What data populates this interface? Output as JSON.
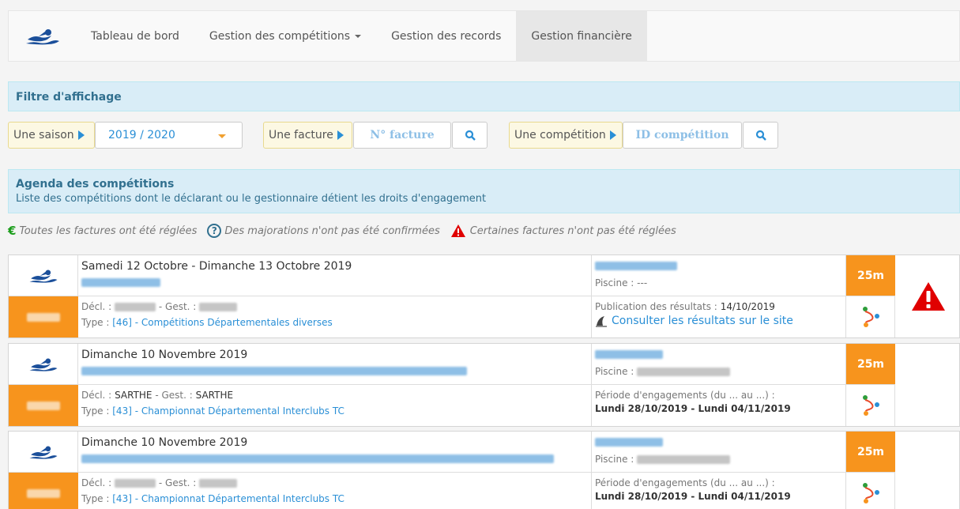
{
  "nav": {
    "items": [
      {
        "label": "Tableau de bord"
      },
      {
        "label": "Gestion des compétitions"
      },
      {
        "label": "Gestion des records"
      },
      {
        "label": "Gestion financière"
      }
    ]
  },
  "filter": {
    "title": "Filtre d'affichage",
    "season_label": "Une saison",
    "season_value": "2019 / 2020",
    "invoice_label": "Une facture",
    "invoice_placeholder": "N° facture",
    "competition_label": "Une compétition",
    "competition_placeholder": "ID compétition"
  },
  "agenda": {
    "title": "Agenda des compétitions",
    "subtitle": "Liste des compétitions dont le déclarant ou le gestionnaire détient les droits d'engagement"
  },
  "legend": {
    "paid": "Toutes les factures ont été réglées",
    "surcharge": "Des majorations n'ont pas été confirmées",
    "unpaid": "Certaines factures n'ont pas été réglées"
  },
  "competitions": [
    {
      "date": "Samedi 12 Octobre  - Dimanche 13 Octobre 2019",
      "decl_prefix": "Décl. :",
      "decl": "",
      "gest_prefix": " - Gest. :",
      "gest": "",
      "type_prefix": "Type :",
      "type": "[46] - Compétitions Départementales diverses",
      "pool_label": "Piscine :",
      "pool": "---",
      "info_label": "Publication des résultats :",
      "info_value": "14/10/2019",
      "link": "Consulter les résultats sur le site",
      "pool_length": "25m",
      "alert": true
    },
    {
      "date": "Dimanche 10 Novembre 2019",
      "decl_prefix": "Décl. :",
      "decl": "SARTHE",
      "gest_prefix": " - Gest. :",
      "gest": "SARTHE",
      "type_prefix": "Type :",
      "type": "[43] - Championnat Départemental Interclubs TC",
      "pool_label": "Piscine :",
      "pool": "",
      "info_label": "Période d'engagements (du ... au ...) :",
      "info_value": "Lundi 28/10/2019 - Lundi 04/11/2019",
      "link": "",
      "pool_length": "25m",
      "alert": false
    },
    {
      "date": "Dimanche 10 Novembre 2019",
      "decl_prefix": "Décl. :",
      "decl": "",
      "gest_prefix": " - Gest. :",
      "gest": "",
      "type_prefix": "Type :",
      "type": "[43] - Championnat Départemental Interclubs TC",
      "pool_label": "Piscine :",
      "pool": "",
      "info_label": "Période d'engagements (du ... au ...) :",
      "info_value": "Lundi 28/10/2019 - Lundi 04/11/2019",
      "link": "",
      "pool_length": "25m",
      "alert": false
    }
  ],
  "colors": {
    "orange": "#f7941d",
    "link": "#2a8fd6",
    "panel": "#d9edf7",
    "alert": "#e00000",
    "paid_green": "#1a9d1a"
  },
  "icons": {
    "logo": "swimmer-icon",
    "search": "search-icon",
    "route": "route-icon",
    "alert": "warning-triangle-icon",
    "paid": "euro-icon",
    "surcharge": "question-circle-icon",
    "results": "shark-fin-icon"
  }
}
